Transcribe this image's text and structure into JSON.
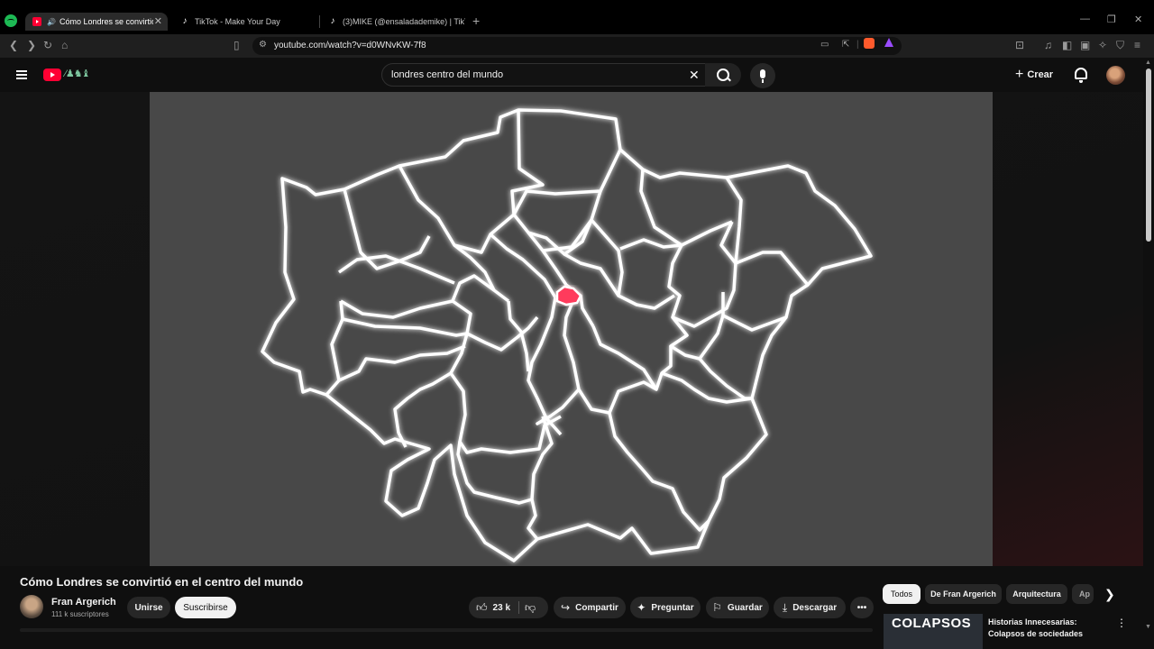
{
  "browser": {
    "tabs": [
      {
        "title": "Cómo Londres se convirtió en el centro del mundo",
        "active": true,
        "icon": "youtube-icon"
      },
      {
        "title": "TikTok - Make Your Day",
        "active": false,
        "icon": "tiktok-icon"
      },
      {
        "title": "(3)MIKE (@ensaladademike) | TikTok",
        "active": false,
        "icon": "tiktok-icon"
      }
    ],
    "url": "youtube.com/watch?v=d0WNvKW-7f8"
  },
  "header": {
    "search_query": "londres centro del mundo",
    "create_label": "Crear"
  },
  "video": {
    "title": "Cómo Londres se convirtió en el centro del mundo",
    "channel": "Fran Argerich",
    "subscribers": "111 k suscriptores",
    "join_label": "Unirse",
    "subscribe_label": "Suscribirse",
    "likes": "23 k",
    "share_label": "Compartir",
    "ask_label": "Preguntar",
    "save_label": "Guardar",
    "download_label": "Descargar",
    "highlight_color": "#ff3b5c"
  },
  "sidebar": {
    "chips": [
      "Todos",
      "De Fran Argerich",
      "Arquitectura",
      "Ap"
    ],
    "related": {
      "thumb_text": "COLAPSOS",
      "title": "Historias Innecesarias: Colapsos de sociedades"
    }
  }
}
